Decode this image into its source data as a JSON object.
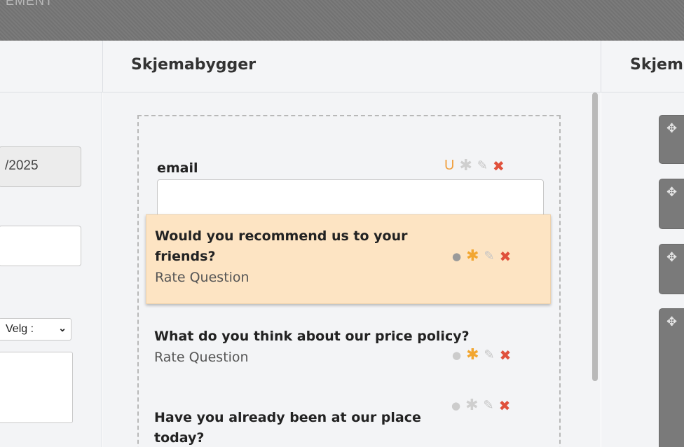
{
  "topbar": {
    "title": "EMENT"
  },
  "columns": {
    "builder_title": "Skjemabygger",
    "preview_title": "Skjem"
  },
  "left_form": {
    "date_value": "/2025",
    "select_value": "Velg :"
  },
  "builder": {
    "fields": [
      {
        "label": "email",
        "unique_badge": "U"
      },
      {
        "label": "Would you recommend us to your friends?",
        "type": "Rate Question",
        "required": true,
        "selected": true
      },
      {
        "label": "What do you think about our price policy?",
        "type": "Rate Question",
        "required": true
      },
      {
        "label": "Have you already been at our place today?",
        "required": false
      }
    ]
  },
  "icons": {
    "move": "move-arrows-icon",
    "required": "star-icon",
    "edit": "pencil-icon",
    "delete": "close-icon",
    "comment": "comment-bubble-icon",
    "dropdown": "chevron-down-icon"
  },
  "colors": {
    "selected_field_bg": "#fde4c3",
    "delete": "#e0513c",
    "required_on": "#f2a630",
    "topbar": "#777777"
  }
}
